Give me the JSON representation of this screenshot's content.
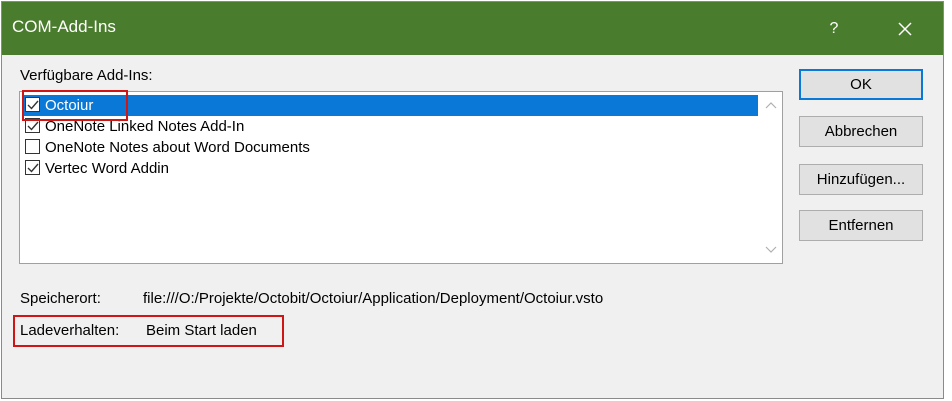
{
  "window": {
    "title": "COM-Add-Ins",
    "help_label": "?",
    "close_icon": "close-icon",
    "title_bar_color": "#4a7c2d"
  },
  "addins": {
    "label": "Verfügbare Add-Ins:",
    "items": [
      {
        "label": "Octoiur",
        "checked": true,
        "selected": true
      },
      {
        "label": "OneNote Linked Notes Add-In",
        "checked": true,
        "selected": false
      },
      {
        "label": "OneNote Notes about Word Documents",
        "checked": false,
        "selected": false
      },
      {
        "label": "Vertec Word Addin",
        "checked": true,
        "selected": false
      }
    ]
  },
  "buttons": {
    "ok": "OK",
    "cancel": "Abbrechen",
    "add": "Hinzufügen...",
    "remove": "Entfernen"
  },
  "details": {
    "location_label": "Speicherort:",
    "location_value": "file:///O:/Projekte/Octobit/Octoiur/Application/Deployment/Octoiur.vsto",
    "load_label": "Ladeverhalten:",
    "load_value": "Beim Start laden"
  },
  "colors": {
    "selection": "#0a78d7",
    "annotation": "#d01515"
  }
}
